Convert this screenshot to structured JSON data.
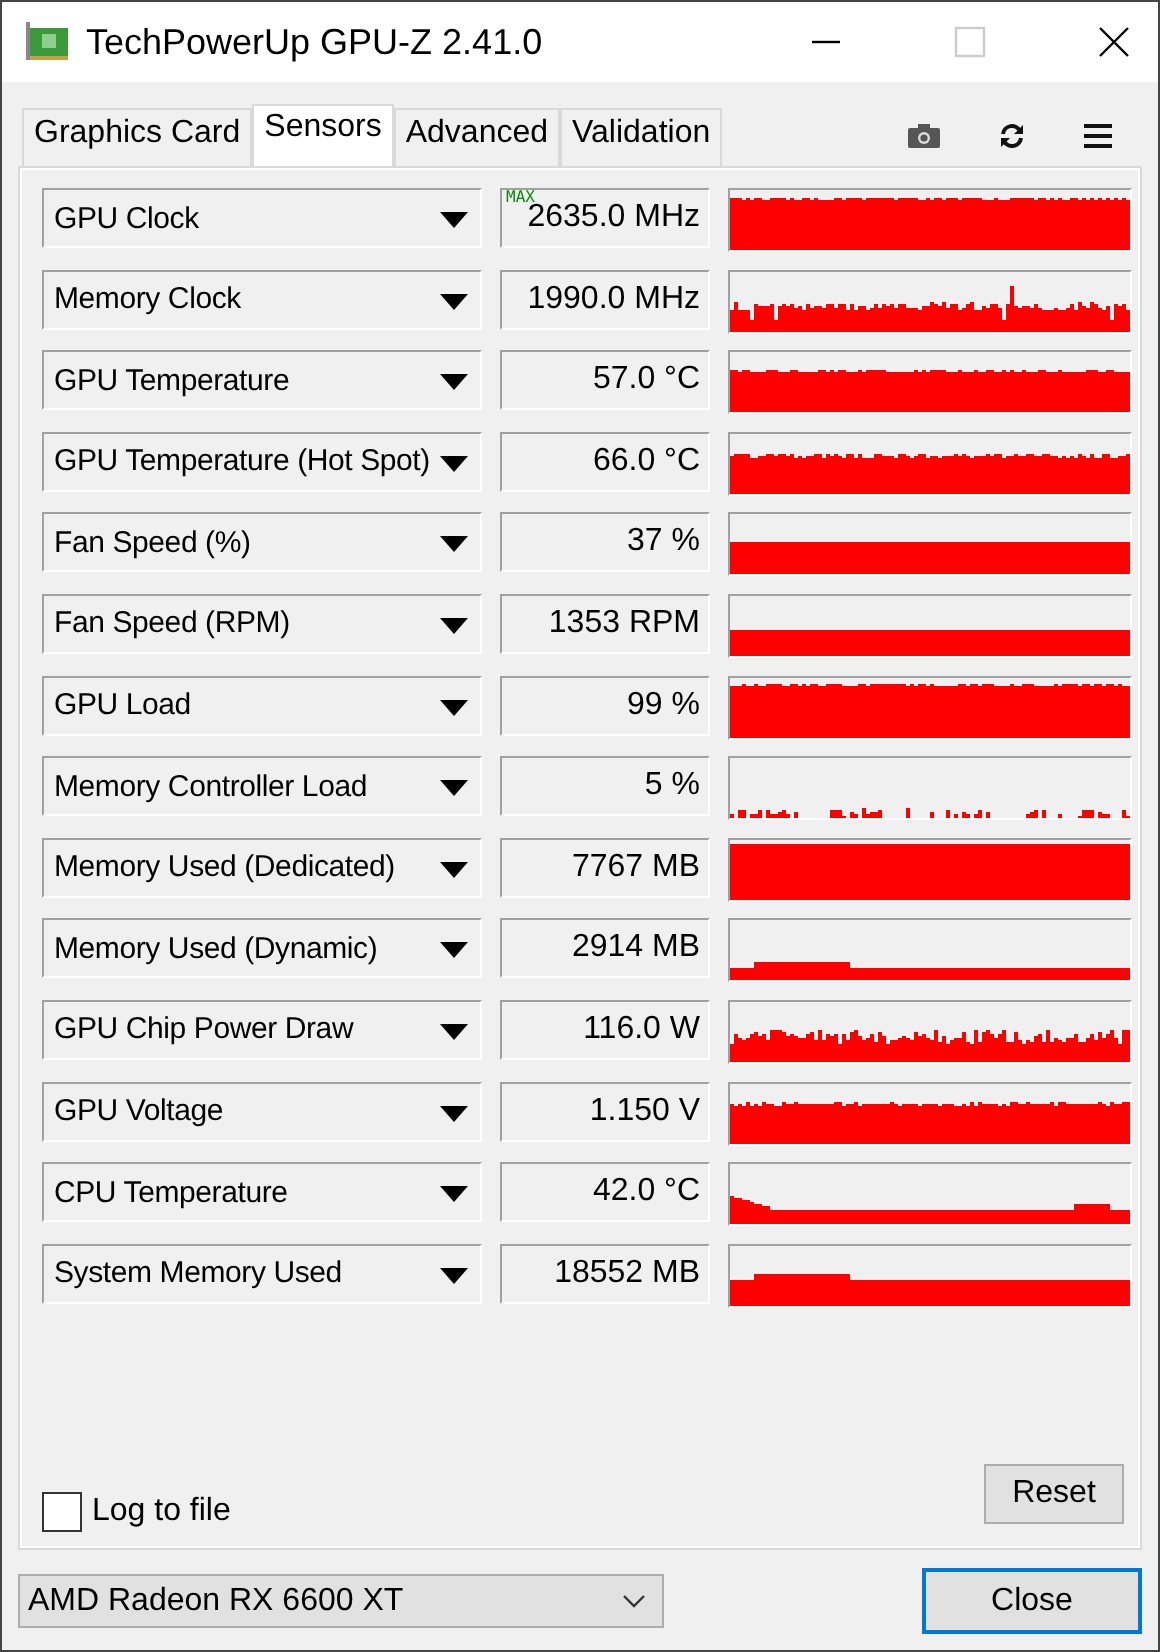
{
  "window": {
    "title": "TechPowerUp GPU-Z 2.41.0"
  },
  "tabs": [
    {
      "label": "Graphics Card",
      "selected": false
    },
    {
      "label": "Sensors",
      "selected": true
    },
    {
      "label": "Advanced",
      "selected": false
    },
    {
      "label": "Validation",
      "selected": false
    }
  ],
  "sensors": [
    {
      "name": "GPU Clock",
      "value": "2635.0 MHz",
      "badge": "MAX"
    },
    {
      "name": "Memory Clock",
      "value": "1990.0 MHz"
    },
    {
      "name": "GPU Temperature",
      "value": "57.0 °C"
    },
    {
      "name": "GPU Temperature (Hot Spot)",
      "value": "66.0 °C"
    },
    {
      "name": "Fan Speed (%)",
      "value": "37 %"
    },
    {
      "name": "Fan Speed (RPM)",
      "value": "1353 RPM"
    },
    {
      "name": "GPU Load",
      "value": "99 %"
    },
    {
      "name": "Memory Controller Load",
      "value": "5 %"
    },
    {
      "name": "Memory Used (Dedicated)",
      "value": "7767 MB"
    },
    {
      "name": "Memory Used (Dynamic)",
      "value": "2914 MB"
    },
    {
      "name": "GPU Chip Power Draw",
      "value": "116.0 W"
    },
    {
      "name": "GPU Voltage",
      "value": "1.150 V"
    },
    {
      "name": "CPU Temperature",
      "value": "42.0 °C"
    },
    {
      "name": "System Memory Used",
      "value": "18552 MB"
    }
  ],
  "log_to_file": {
    "label": "Log to file",
    "checked": false
  },
  "reset_button": "Reset",
  "gpu_select": {
    "value": "AMD Radeon RX 6600 XT"
  },
  "close_button": "Close"
}
